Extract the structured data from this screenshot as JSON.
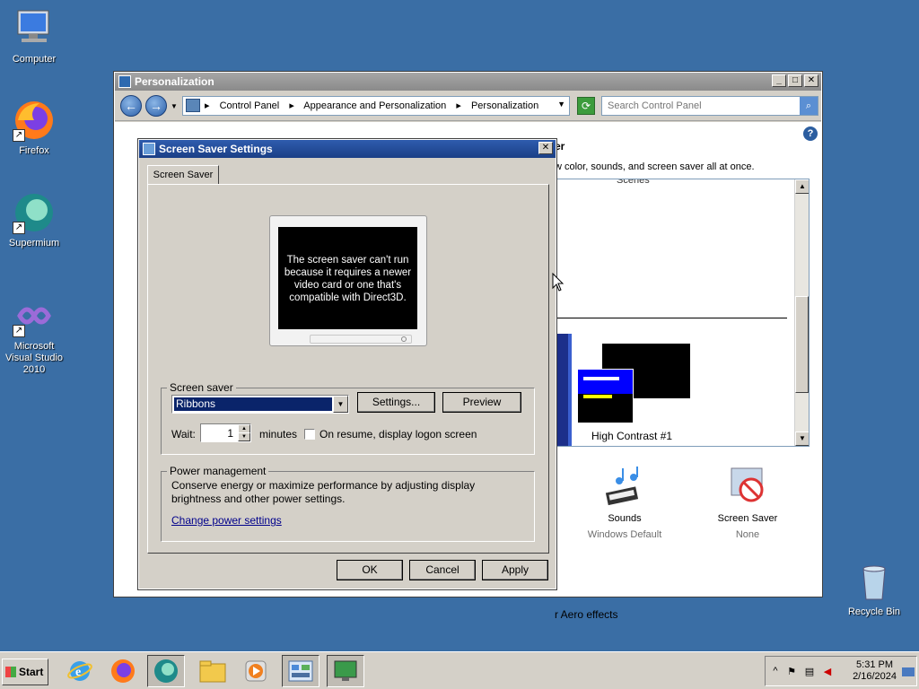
{
  "desktop": {
    "icons": [
      {
        "label": "Computer"
      },
      {
        "label": "Firefox"
      },
      {
        "label": "Supermium"
      },
      {
        "label": "Microsoft Visual Studio 2010"
      },
      {
        "label": "Recycle Bin"
      }
    ]
  },
  "personalization": {
    "title": "Personalization",
    "breadcrumb": [
      "Control Panel",
      "Appearance and Personalization",
      "Personalization"
    ],
    "search_placeholder": "Search Control Panel",
    "heading_fragment": "er",
    "description_fragment": "w color, sounds, and screen saver all at once.",
    "scenes_fragment": "Scenes",
    "theme_label": "High Contrast #1",
    "sounds": {
      "label": "Sounds",
      "sub": "Windows Default"
    },
    "screensaver": {
      "label": "Screen Saver",
      "sub": "None"
    },
    "aero_fragment": "r Aero effects"
  },
  "dialog": {
    "title": "Screen Saver Settings",
    "tab": "Screen Saver",
    "preview_message": "The screen saver can't run because it requires a newer video card or one that's compatible with Direct3D.",
    "screen_saver_group": "Screen saver",
    "selected_screensaver": "Ribbons",
    "settings_button": "Settings...",
    "preview_button": "Preview",
    "wait_label": "Wait:",
    "wait_value": "1",
    "minutes_label": "minutes",
    "on_resume_label": "On resume, display logon screen",
    "on_resume_checked": false,
    "power_group": "Power management",
    "power_text": "Conserve energy or maximize performance by adjusting display brightness and other power settings.",
    "power_link": "Change power settings",
    "ok": "OK",
    "cancel": "Cancel",
    "apply": "Apply"
  },
  "taskbar": {
    "start": "Start",
    "time": "5:31 PM",
    "date": "2/16/2024"
  },
  "colors": {
    "desktop": "#3a6ea5",
    "dialog_titlebar": "#1b3f86",
    "selection": "#0a246a"
  }
}
